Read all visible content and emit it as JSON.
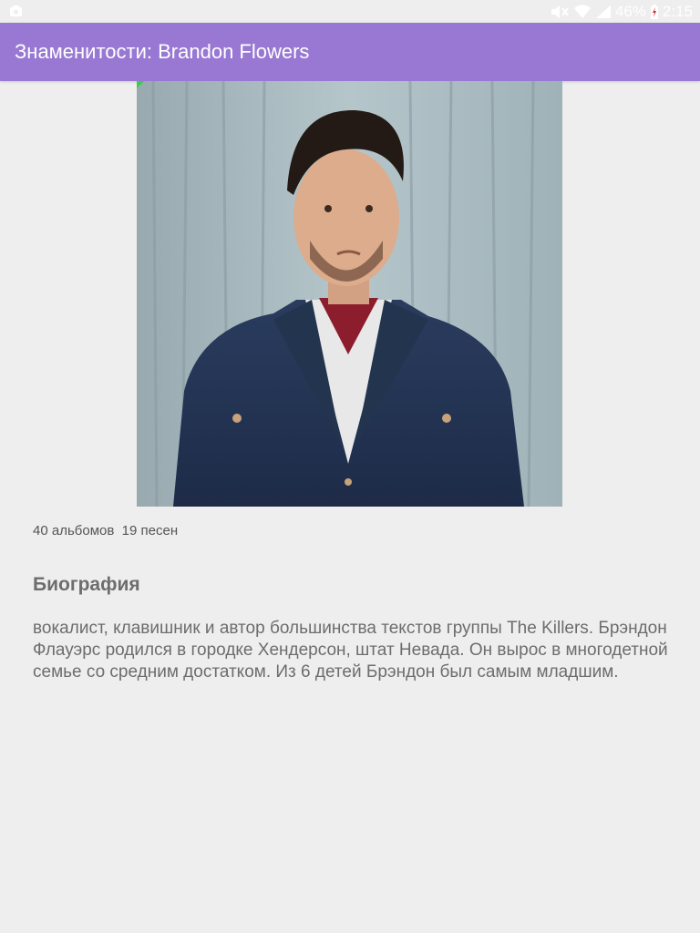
{
  "status_bar": {
    "battery": "46%",
    "time": "2:15",
    "icons": [
      "notification-icon",
      "mute-icon",
      "wifi-icon",
      "signal-icon",
      "battery-icon"
    ]
  },
  "app_bar": {
    "title": "Знаменитости: Brandon Flowers",
    "color": "#9878d3"
  },
  "profile": {
    "photo": "person-photo",
    "counts": "40 альбомов  19 песен"
  },
  "biography": {
    "heading": "Биография",
    "text": "вокалист, клавишник и автор большинства текстов группы The Killers. Брэндон Флауэрс родился в городке Хендерсон, штат Невада. Он вырос в многодетной семье со средним достатком. Из 6 детей Брэндон был самым младшим."
  }
}
